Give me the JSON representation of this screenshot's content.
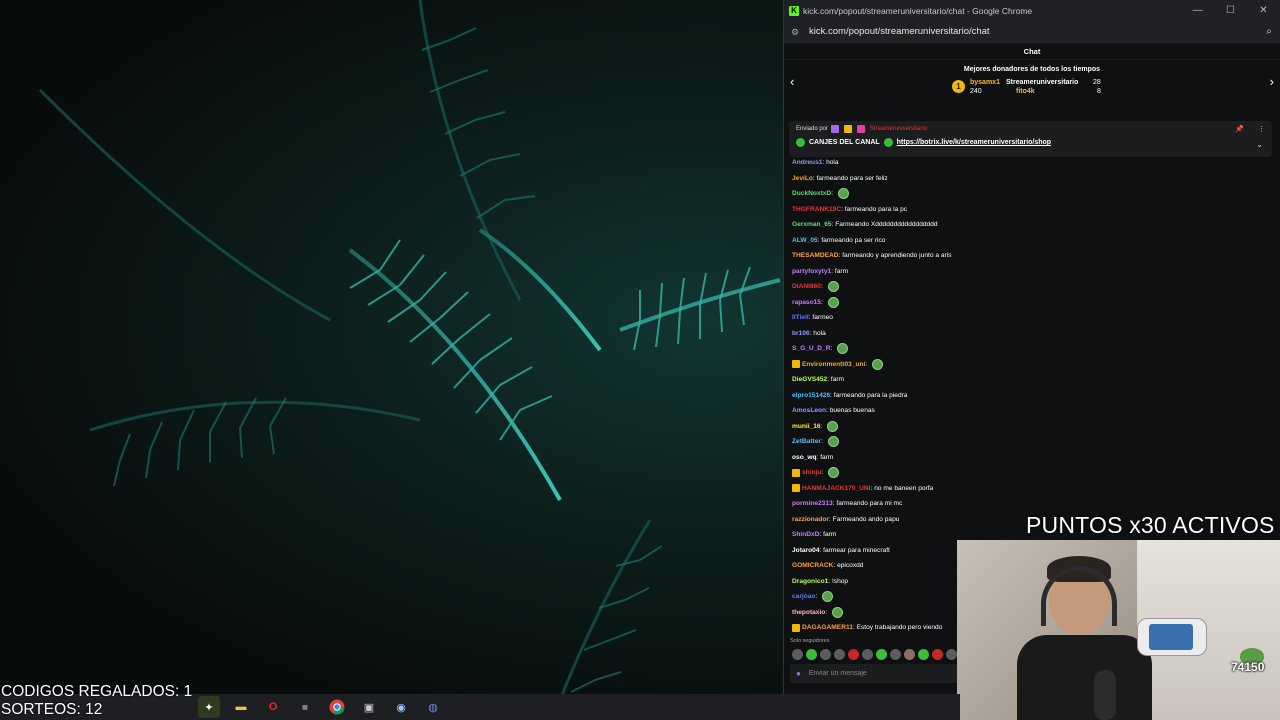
{
  "window": {
    "title": "kick.com/popout/streameruniversitario/chat - Google Chrome",
    "url": "kick.com/popout/streameruniversitario/chat",
    "controls": [
      "—",
      "☐",
      "✕"
    ]
  },
  "chat": {
    "header": "Chat",
    "donors_title": "Mejores donadores de todos los tiempos",
    "donors": [
      {
        "name": "bysamx1",
        "amount": "240"
      },
      {
        "name": "Streameruniversitario",
        "amount": "28"
      },
      {
        "name": "fito4k",
        "amount": "8"
      }
    ],
    "pinned": {
      "sent_by": "Enviado por",
      "author": "Streameruniversitario",
      "message": "CANJES DEL CANAL",
      "link": "https://botrix.live/k/streameruniversitario/shop"
    },
    "messages": [
      {
        "user": "Andreus1",
        "color": "#8f9bff",
        "text": "hola"
      },
      {
        "user": "JeviLo",
        "color": "#f5a623",
        "text": "farmeando para ser feliz"
      },
      {
        "user": "DuckNoxtxD",
        "color": "#53e07a",
        "text": "",
        "emote": true
      },
      {
        "user": "THGFRANK19C",
        "color": "#e53935",
        "text": "farmeando para la pc"
      },
      {
        "user": "Gerxman_65",
        "color": "#53e07a",
        "text": "Farmeando Xddddddddddddddddd"
      },
      {
        "user": "ALW_05",
        "color": "#4fc3f7",
        "text": "farmeando pa ser rico"
      },
      {
        "user": "THESAMDEAD",
        "color": "#ff9f40",
        "text": "farmeando y aprendiendo junto a aris"
      },
      {
        "user": "partyfoxyty1",
        "color": "#c77dff",
        "text": "farm"
      },
      {
        "user": "DIANI860",
        "color": "#e53935",
        "text": "",
        "emote": true
      },
      {
        "user": "rapaso15",
        "color": "#c77dff",
        "text": "",
        "emote": true
      },
      {
        "user": "IlTiell",
        "color": "#5c7cfa",
        "text": "farmeo"
      },
      {
        "user": "br106",
        "color": "#8f9bff",
        "text": "hola"
      },
      {
        "user": "S_G_U_D_R",
        "color": "#c77dff",
        "text": "",
        "emote": true
      },
      {
        "user": "Environmentt03_uni",
        "color": "#f5a623",
        "text": "",
        "emote": true,
        "badges": true
      },
      {
        "user": "DieGVS452",
        "color": "#b2ff59",
        "text": "farm"
      },
      {
        "user": "elpro151426",
        "color": "#4fc3f7",
        "text": "farmeando para la piedra"
      },
      {
        "user": "AmosLeon",
        "color": "#8f9bff",
        "text": "buenas buenas"
      },
      {
        "user": "munii_16",
        "color": "#ffeb3b",
        "text": "",
        "emote": true
      },
      {
        "user": "ZetBatter",
        "color": "#4fc3f7",
        "text": "",
        "emote": true
      },
      {
        "user": "oso_wq",
        "color": "#ffffff",
        "text": "farm"
      },
      {
        "user": "shinju",
        "color": "#e53935",
        "text": "",
        "emote": true,
        "badges": true
      },
      {
        "user": "HANMAJACK170_UNI",
        "color": "#e53935",
        "text": "no me baneen porfa",
        "badges": true
      },
      {
        "user": "pormine2313",
        "color": "#c77dff",
        "text": "farmeando para mi mc"
      },
      {
        "user": "razzionador",
        "color": "#ff9f40",
        "text": "Farmeando ando papu"
      },
      {
        "user": "ShinDxD",
        "color": "#c77dff",
        "text": "farm"
      },
      {
        "user": "Jotaro04",
        "color": "#ffffff",
        "text": "farmear para minecraft"
      },
      {
        "user": "GOMICRACK",
        "color": "#ff9f40",
        "text": "epicoxdd"
      },
      {
        "user": "Dragonico1",
        "color": "#b2ff59",
        "text": "!shop"
      },
      {
        "user": "carjoao",
        "color": "#5c7cfa",
        "text": "",
        "emote": true
      },
      {
        "user": "thepotaxio",
        "color": "#ffb3c6",
        "text": "",
        "emote": true
      },
      {
        "user": "DAGAGAMER11",
        "color": "#ff9f40",
        "text": "Estoy trabajando pero viendo",
        "badges": true
      }
    ],
    "followers_only": "Solo seguidores",
    "input_placeholder": "Enviar un mensaje"
  },
  "overlay": {
    "codigos": "CODIGOS REGALADOS: 1",
    "sorteos": "SORTEOS: 12",
    "points_banner": "PUNTOS x30 ACTIVOS",
    "points_counter": "74150"
  },
  "taskbar": {
    "icons": [
      "sparkle-icon",
      "folder-icon",
      "opera-icon",
      "lucky-patcher-icon",
      "chrome-icon",
      "app-icon",
      "steam-icon",
      "discord-icon"
    ]
  }
}
